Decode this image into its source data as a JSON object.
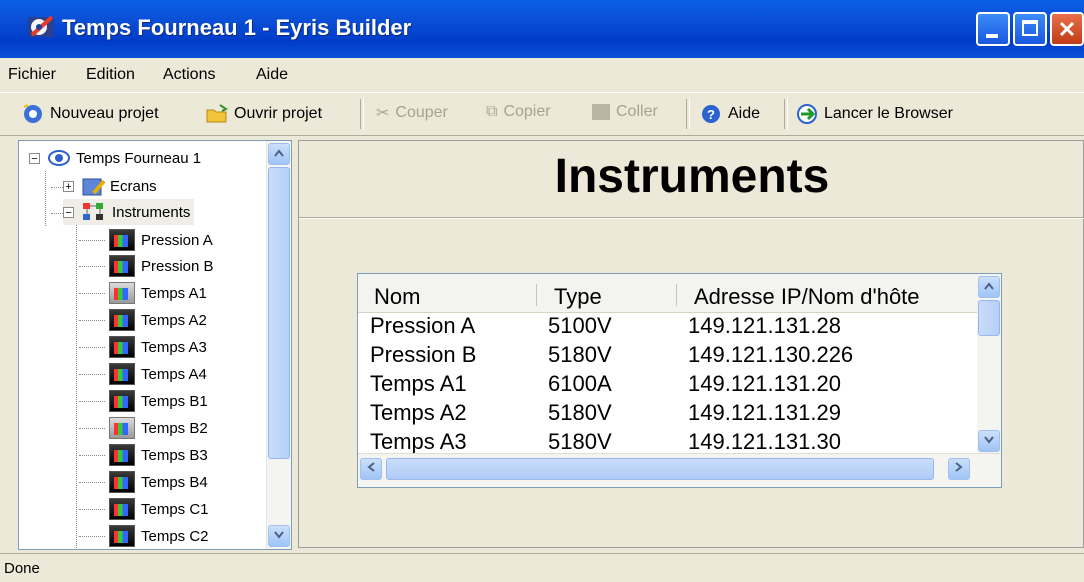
{
  "window": {
    "title": "Temps Fourneau 1 - Eyris Builder",
    "icon": "app-icon"
  },
  "menu": [
    "Fichier",
    "Edition",
    "Actions",
    "Aide"
  ],
  "toolbar": {
    "new_project": "Nouveau projet",
    "open_project": "Ouvrir projet",
    "cut": "Couper",
    "copy": "Copier",
    "paste": "Coller",
    "help": "Aide",
    "launch_browser": "Lancer le Browser"
  },
  "tree": {
    "root": "Temps Fourneau 1",
    "screens": "Ecrans",
    "instruments": "Instruments",
    "items": [
      "Pression A",
      "Pression B",
      "Temps A1",
      "Temps A2",
      "Temps A3",
      "Temps A4",
      "Temps B1",
      "Temps B2",
      "Temps B3",
      "Temps B4",
      "Temps C1",
      "Temps C2"
    ]
  },
  "content": {
    "heading": "Instruments",
    "columns": [
      "Nom",
      "Type",
      "Adresse IP/Nom d'hôte"
    ],
    "rows": [
      [
        "Pression A",
        "5100V",
        "149.121.131.28"
      ],
      [
        "Pression B",
        "5180V",
        "149.121.130.226"
      ],
      [
        "Temps A1",
        "6100A",
        "149.121.131.20"
      ],
      [
        "Temps A2",
        "5180V",
        "149.121.131.29"
      ],
      [
        "Temps A3",
        "5180V",
        "149.121.131.30"
      ]
    ]
  },
  "status": "Done",
  "colors": {
    "titlebar": "#0a4fd6",
    "chrome": "#ece9d8",
    "scrollbar": "#b6cff8"
  }
}
